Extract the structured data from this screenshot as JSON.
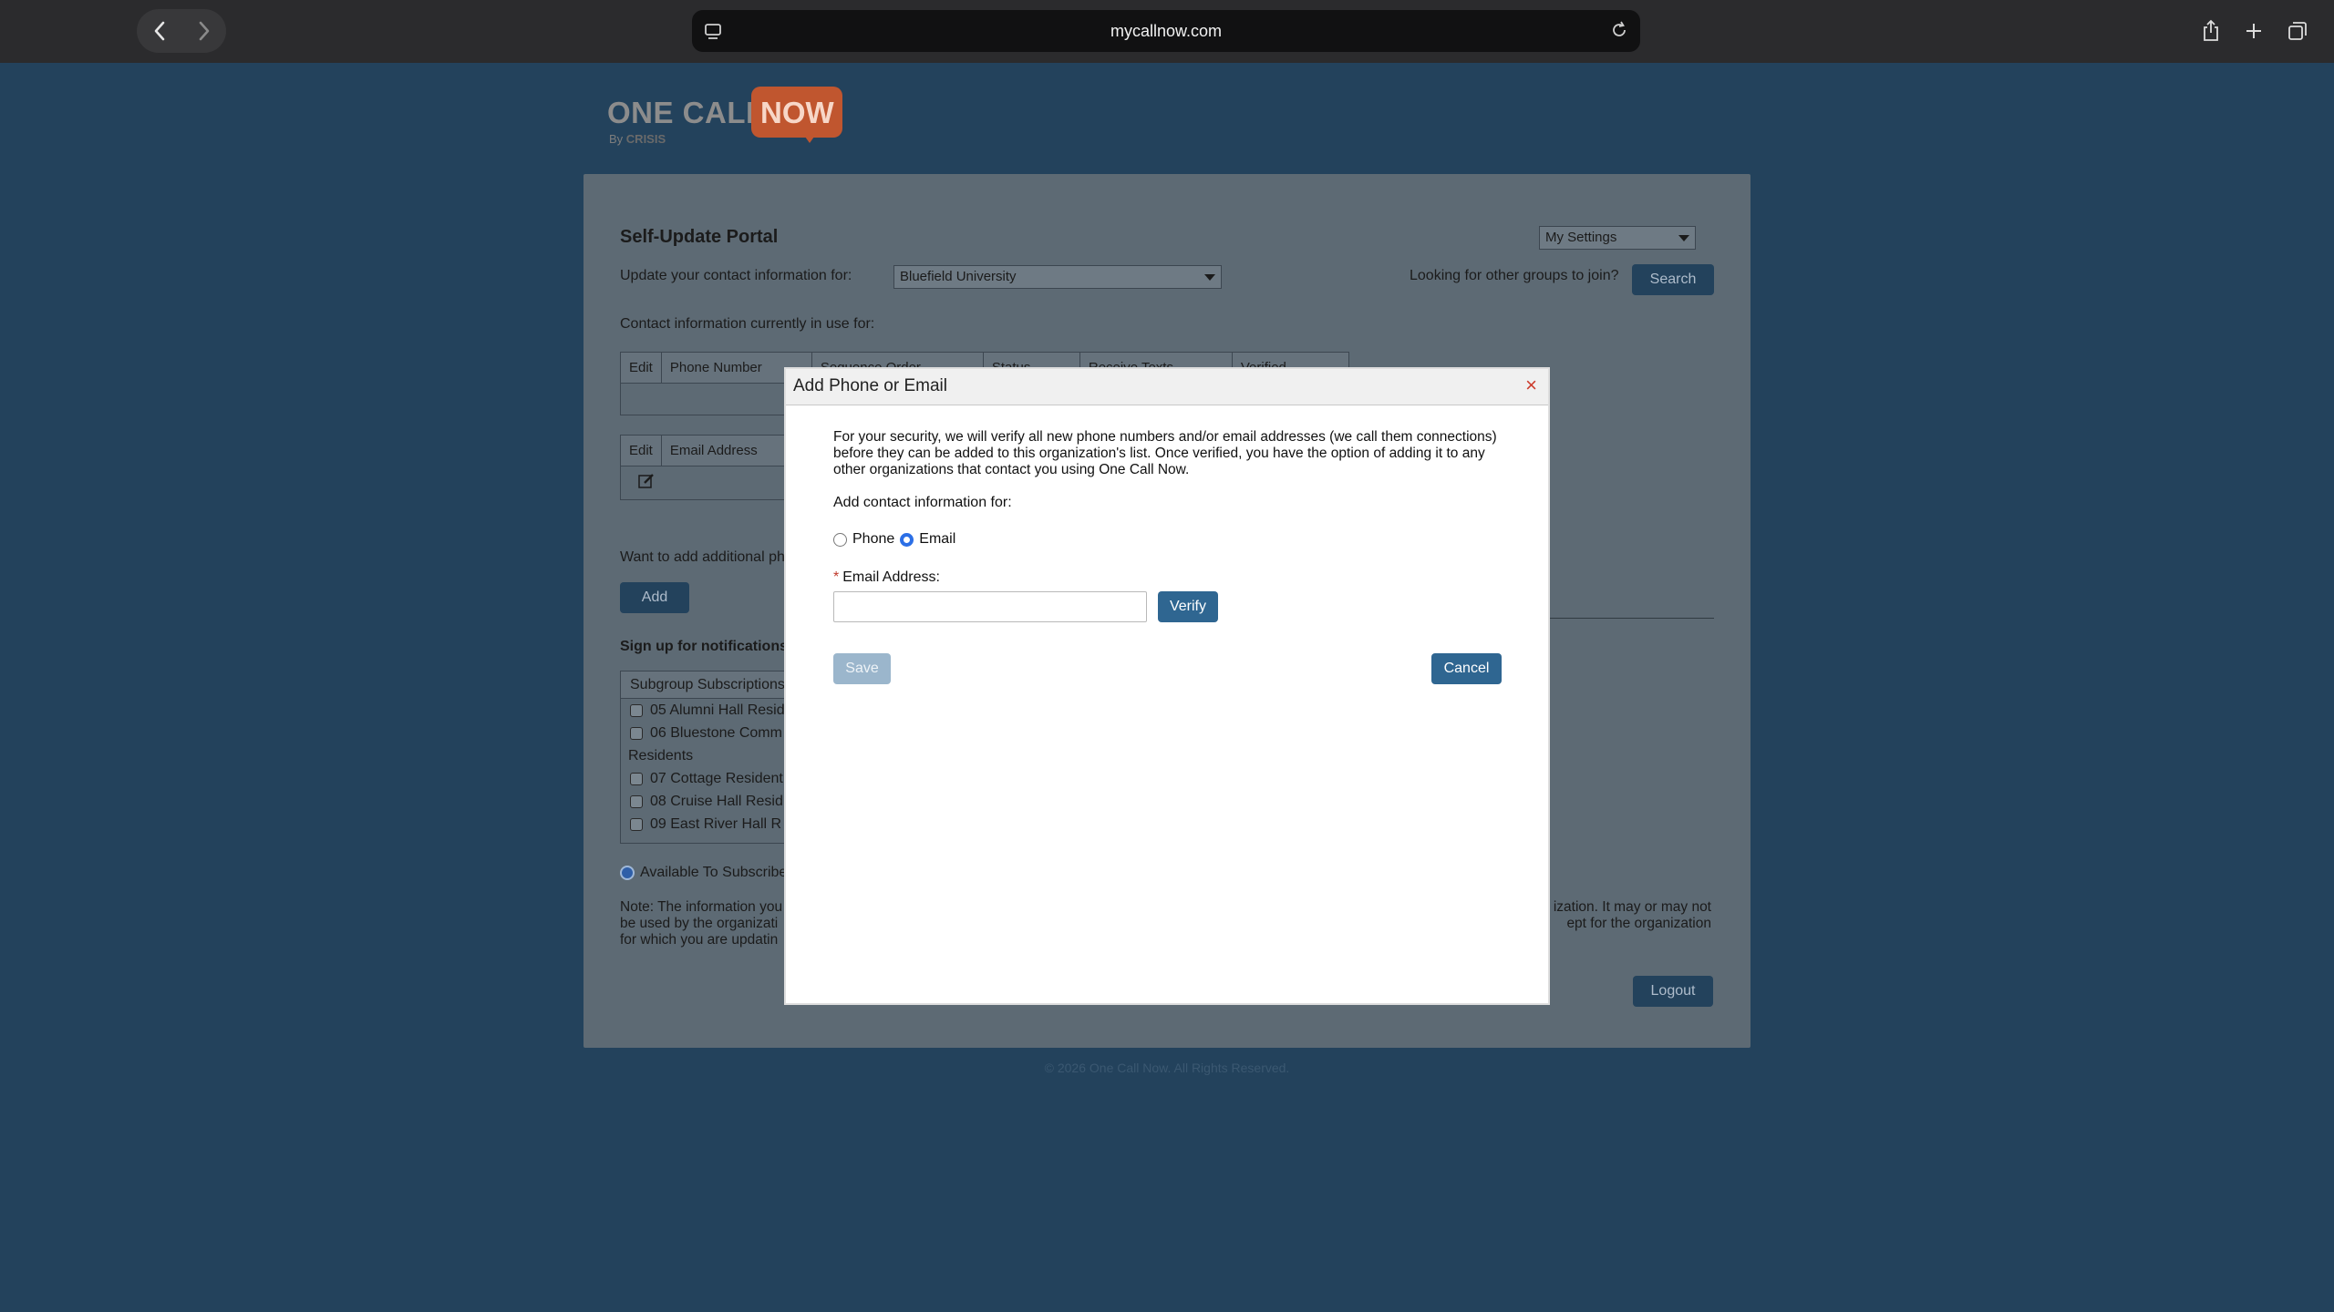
{
  "browser": {
    "url": "mycallnow.com"
  },
  "logo": {
    "one_call": "ONE CALL",
    "now": "NOW",
    "by": "By",
    "crisis": "CRISIS"
  },
  "portal": {
    "title": "Self-Update Portal",
    "settings_select": "My Settings",
    "update_for_label": "Update your contact information for:",
    "organization_select": "Bluefield University",
    "other_groups_label": "Looking for other groups to join?",
    "search_button": "Search",
    "contact_in_use_label": "Contact information currently in use for:",
    "phone_table_headers": [
      "Edit",
      "Phone Number",
      "Sequence Order",
      "Status",
      "Receive Texts",
      "Verified"
    ],
    "email_table_headers": [
      "Edit",
      "Email Address"
    ],
    "add_more_label": "Want to add additional ph",
    "add_button": "Add",
    "signup_label": "Sign up for notifications",
    "subgroup_header": "Subgroup Subscriptions",
    "subgroups": [
      "05 Alumni Hall Resid",
      "06 Bluestone Comm",
      "Residents",
      "07 Cottage Resident",
      "08 Cruise Hall Resid",
      "09 East River Hall R"
    ],
    "available_label": "Available To Subscribe",
    "note_left_lines": [
      "Note: The information you",
      "be used by the organizati",
      "for which you are updatin"
    ],
    "note_right_lines": [
      "ization. It may or may not",
      "ept for the organization"
    ],
    "logout_button": "Logout"
  },
  "footer": "© 2026 One Call Now. All Rights Reserved.",
  "modal": {
    "title": "Add Phone or Email",
    "close": "×",
    "intro": "For your security, we will verify all new phone numbers and/or email addresses (we call them connections) before they can be added to this organization's list. Once verified, you have the option of adding it to any other organizations that contact you using One Call Now.",
    "add_for_label": "Add contact information for:",
    "option_phone": "Phone",
    "option_email": "Email",
    "selected_option": "Email",
    "required_mark": "*",
    "email_label": "Email Address:",
    "email_value": "",
    "verify_button": "Verify",
    "save_button": "Save",
    "cancel_button": "Cancel"
  },
  "colors": {
    "overlay_background": "#23425c",
    "primary_button": "#2f6691",
    "close_icon": "#cc3a2a",
    "radio_selected": "#2c6fe6"
  }
}
